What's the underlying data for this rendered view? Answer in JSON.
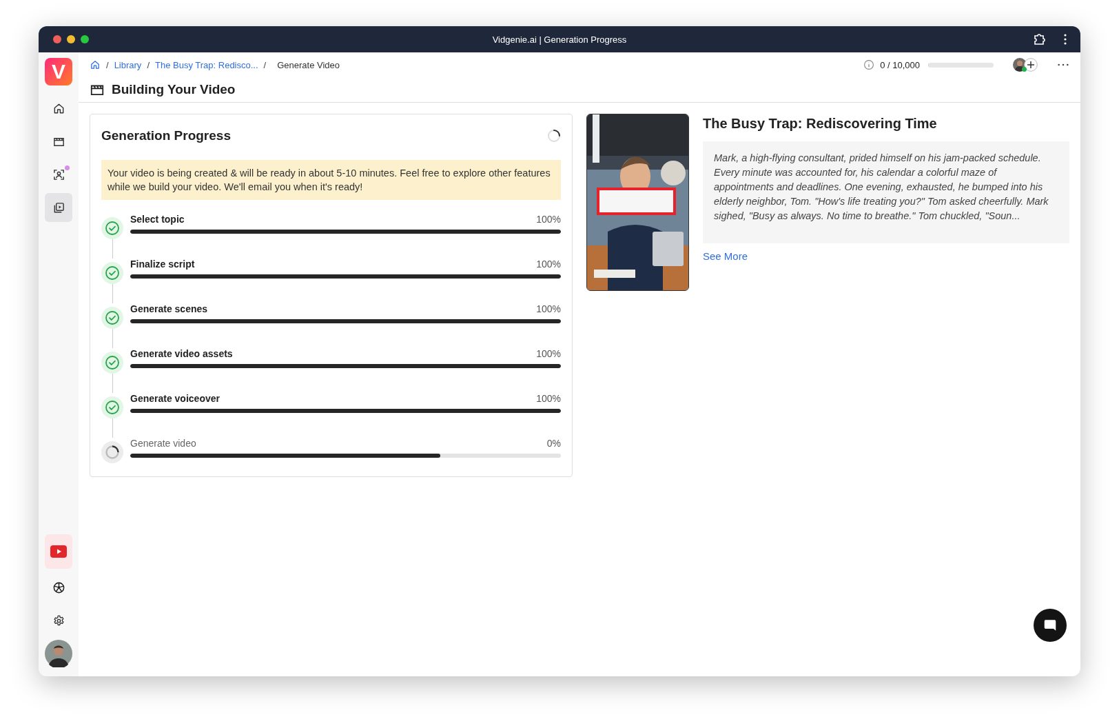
{
  "window": {
    "title": "Vidgenie.ai | Generation Progress"
  },
  "logo": "V",
  "sidebar": {
    "items": [
      {
        "kind": "home",
        "selected": false,
        "badge": false
      },
      {
        "kind": "clapperboard",
        "selected": false,
        "badge": false
      },
      {
        "kind": "person-scan",
        "selected": false,
        "badge": true
      },
      {
        "kind": "video-library",
        "selected": true,
        "badge": false
      }
    ],
    "bottom_items": [
      {
        "kind": "youtube",
        "selected": true
      },
      {
        "kind": "ball",
        "selected": false
      },
      {
        "kind": "settings",
        "selected": false
      },
      {
        "kind": "avatar",
        "selected": false
      }
    ]
  },
  "breadcrumb": [
    {
      "separator": "/",
      "label": "Library",
      "kind": "link"
    },
    {
      "separator": "/",
      "label": "The Busy Trap: Redisco...",
      "kind": "link"
    },
    {
      "separator": "/",
      "label": "Generate Video",
      "kind": "current"
    }
  ],
  "credits": {
    "text": "0 / 10,000",
    "level": 0
  },
  "page_title": "Building Your Video",
  "progress": {
    "title": "Generation Progress",
    "notice": "Your video is being created & will be ready in about 5-10 minutes. Feel free to explore other features while we build your video. We'll email you when it's ready!",
    "steps": [
      {
        "label": "Select topic",
        "reading": "100%",
        "level": 1,
        "kind": "done"
      },
      {
        "label": "Finalize script",
        "reading": "100%",
        "level": 1,
        "kind": "done"
      },
      {
        "label": "Generate scenes",
        "reading": "100%",
        "level": 1,
        "kind": "done"
      },
      {
        "label": "Generate video assets",
        "reading": "100%",
        "level": 1,
        "kind": "done"
      },
      {
        "label": "Generate voiceover",
        "reading": "100%",
        "level": 1,
        "kind": "done"
      },
      {
        "label": "Generate video",
        "reading": "0%",
        "level": 0.72,
        "kind": "running"
      }
    ]
  },
  "story": {
    "title": "The Busy Trap: Rediscovering Time",
    "text": "Mark, a high-flying consultant, prided himself on his jam-packed schedule. Every minute was accounted for, his calendar a colorful maze of appointments and deadlines. One evening, exhausted, he bumped into his elderly neighbor, Tom. \"How's life treating you?\" Tom asked cheerfully. Mark sighed, \"Busy as always. No time to breathe.\" Tom chuckled, \"Soun...",
    "link": "See More"
  }
}
